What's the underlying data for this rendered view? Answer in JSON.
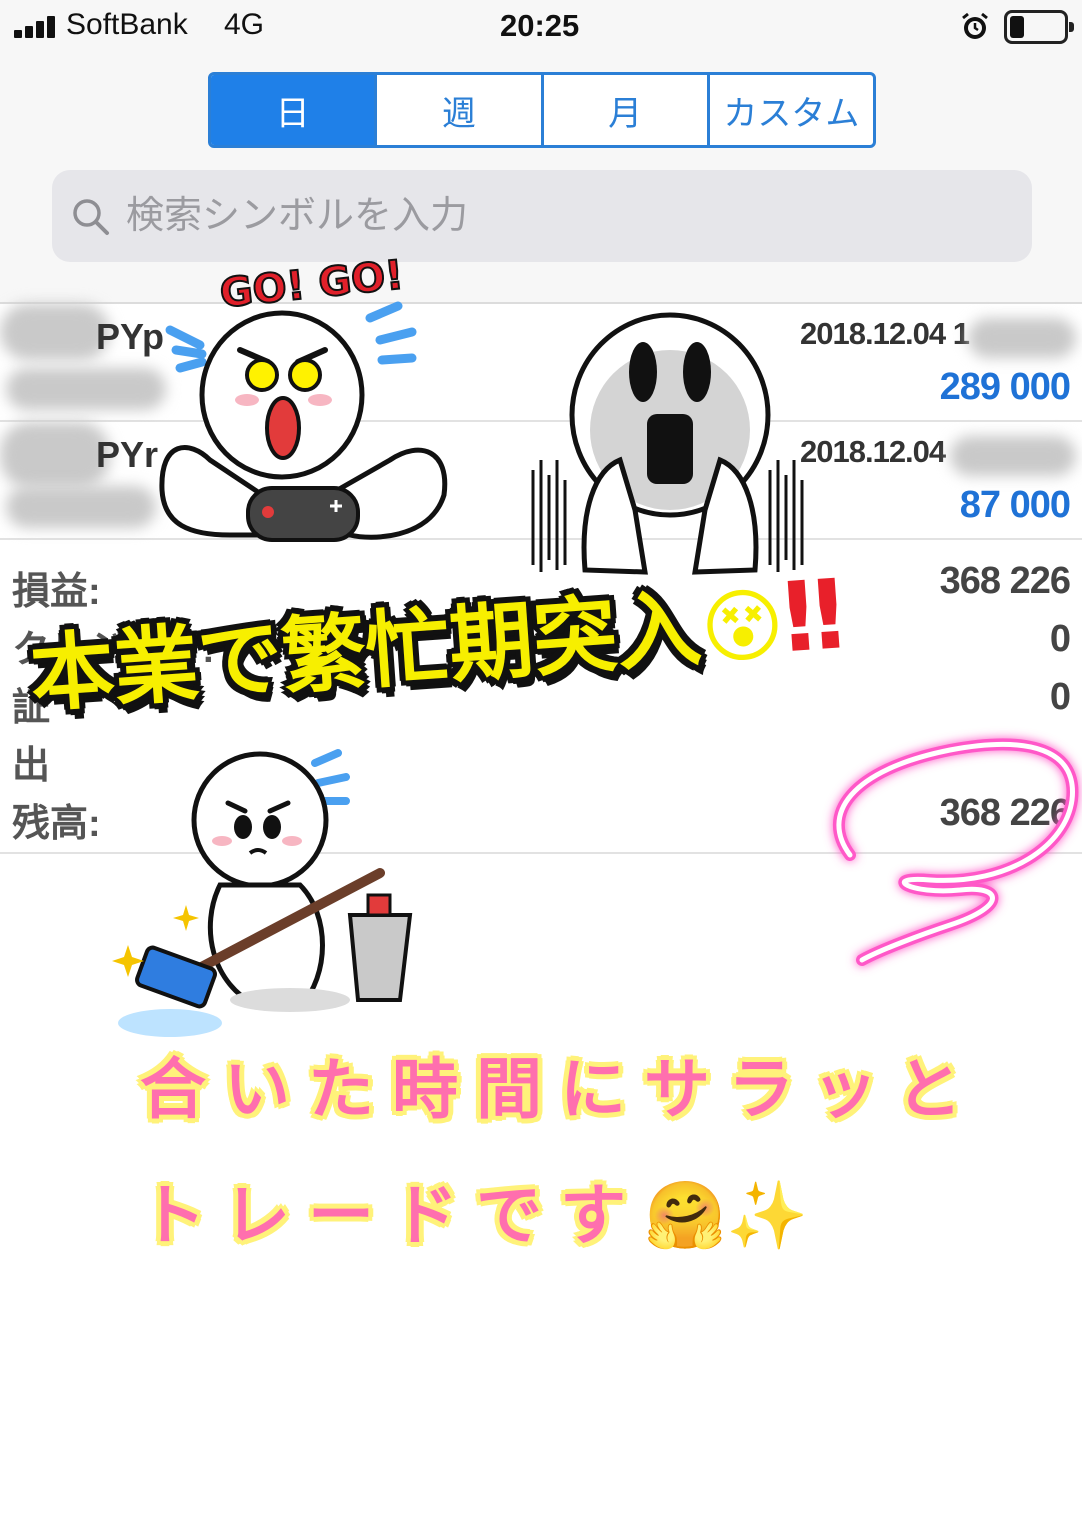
{
  "status_bar": {
    "carrier": "SoftBank",
    "network": "4G",
    "time": "20:25"
  },
  "tabs": [
    {
      "label": "日",
      "active": true
    },
    {
      "label": "週",
      "active": false
    },
    {
      "label": "月",
      "active": false
    },
    {
      "label": "カスタム",
      "active": false
    }
  ],
  "search": {
    "placeholder": "検索シンボルを入力",
    "value": ""
  },
  "positions": [
    {
      "symbol_fragment": "PYp",
      "time": "2018.12.04 1",
      "profit": "289 000"
    },
    {
      "symbol_fragment": "PYr",
      "time": "2018.12.04",
      "profit": "87 000"
    }
  ],
  "summary": [
    {
      "label": "損益:",
      "value": "368 226"
    },
    {
      "label": "クレジット:",
      "value": "0"
    },
    {
      "label": "証",
      "value": "0"
    },
    {
      "label": "出",
      "value": ""
    },
    {
      "label": "残高:",
      "value": "368 226"
    }
  ],
  "overlays": {
    "sticker_text": "GO! GO!",
    "banner": "本業で繁忙期突入",
    "banner_emoji": "😵",
    "banner_marks": "‼",
    "caption_line1": "合いた時間にサラッと",
    "caption_line2": "トレードです",
    "caption_emoji": "🤗✨"
  },
  "colors": {
    "accent_blue": "#1f80e8",
    "profit_blue": "#1f72d6",
    "banner_yellow": "#f7ef00",
    "caption_pink": "#ff6fae",
    "highlight_pink": "#ff59c8"
  }
}
